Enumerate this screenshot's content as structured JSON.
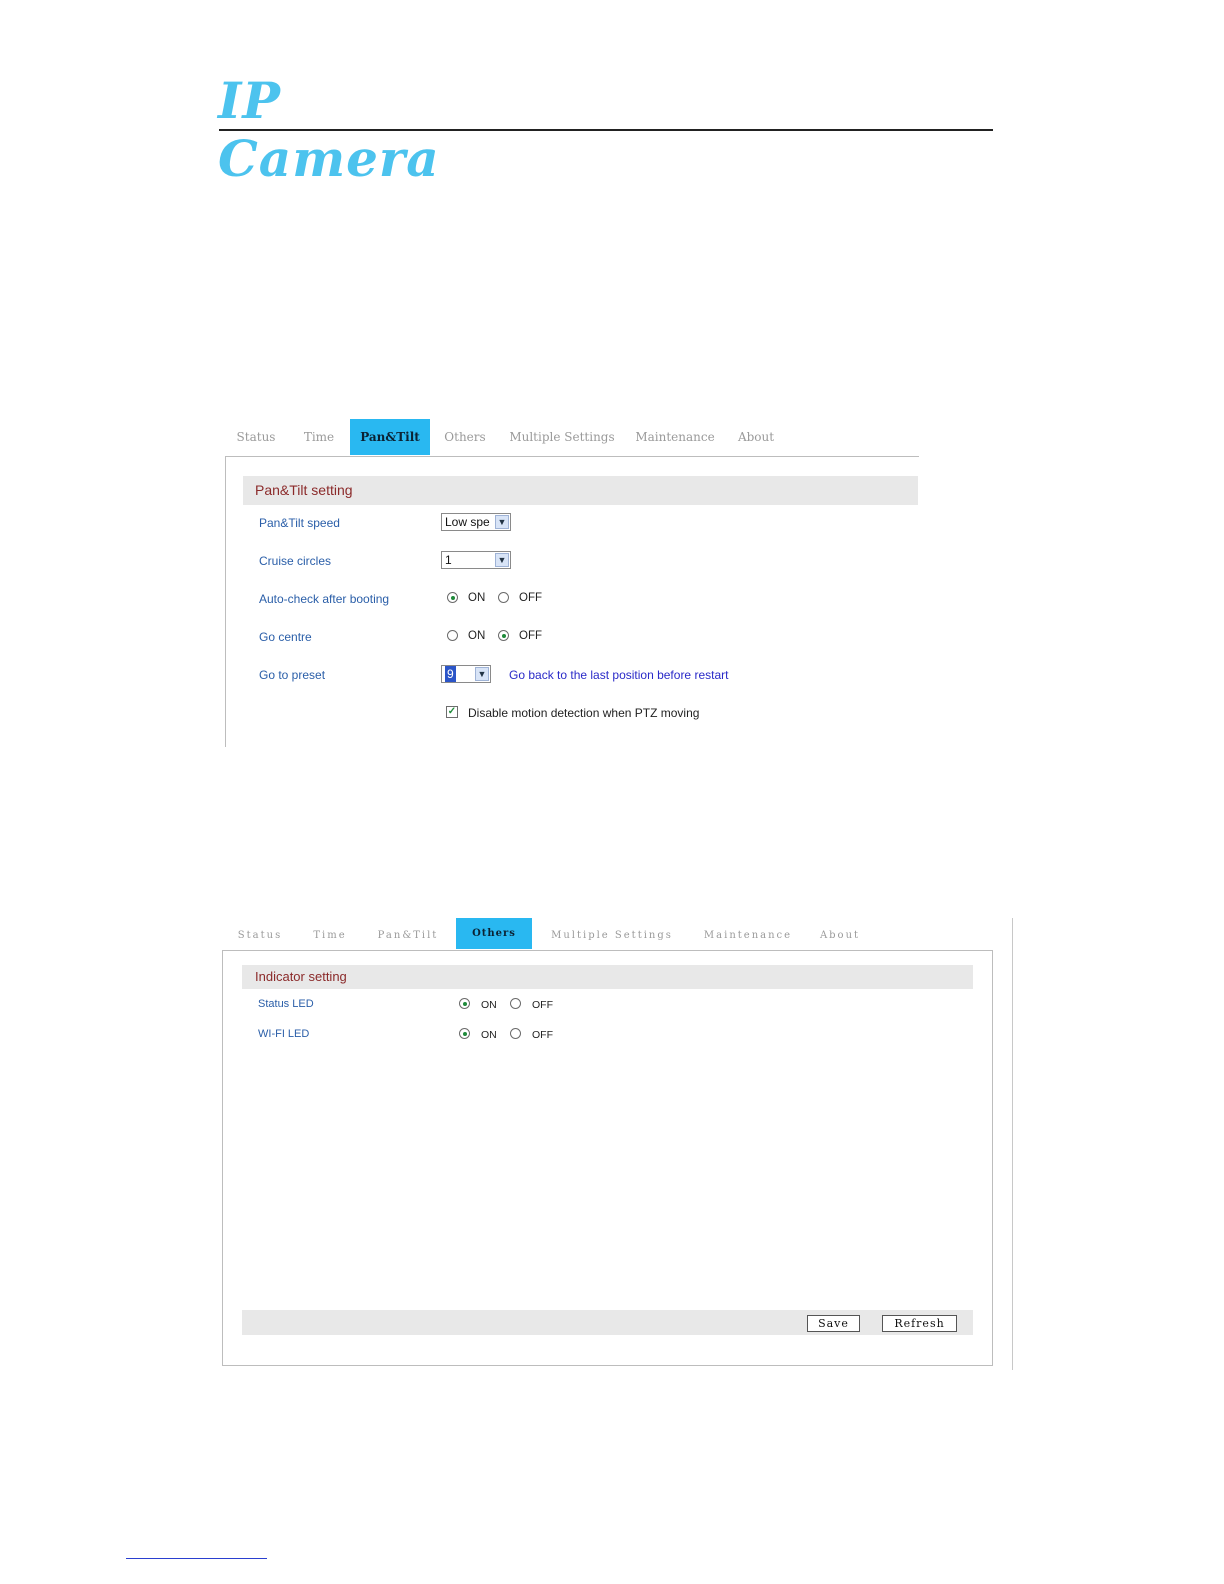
{
  "brand": {
    "logo_text": "IP Camera"
  },
  "panel1": {
    "tabs": [
      "Status",
      "Time",
      "Pan&Tilt",
      "Others",
      "Multiple Settings",
      "Maintenance",
      "About"
    ],
    "active_tab": "Pan&Tilt",
    "section_title": "Pan&Tilt setting",
    "rows": {
      "speed": {
        "label": "Pan&Tilt speed",
        "value": "Low spe"
      },
      "cruise": {
        "label": "Cruise circles",
        "value": "1"
      },
      "autocheck": {
        "label": "Auto-check after booting",
        "on": "ON",
        "off": "OFF",
        "selected": "ON"
      },
      "gocentre": {
        "label": "Go centre",
        "on": "ON",
        "off": "OFF",
        "selected": "OFF"
      },
      "preset": {
        "label": "Go to preset",
        "value": "9",
        "hint": "Go back to the last position before restart"
      },
      "motion": {
        "label": "Disable motion detection when PTZ moving",
        "checked": true
      }
    }
  },
  "panel2": {
    "tabs": [
      "Status",
      "Time",
      "Pan&Tilt",
      "Others",
      "Multiple Settings",
      "Maintenance",
      "About"
    ],
    "active_tab": "Others",
    "section_title": "Indicator setting",
    "rows": {
      "status_led": {
        "label": "Status LED",
        "on": "ON",
        "off": "OFF",
        "selected": "ON"
      },
      "wifi_led": {
        "label": "WI-FI LED",
        "on": "ON",
        "off": "OFF",
        "selected": "ON"
      }
    },
    "buttons": {
      "save": "Save",
      "refresh": "Refresh"
    }
  },
  "colors": {
    "accent": "#29b8f1",
    "label_blue": "#2a5ea8",
    "section_title": "#8b2a2a",
    "logo": "#4cc3ee"
  }
}
